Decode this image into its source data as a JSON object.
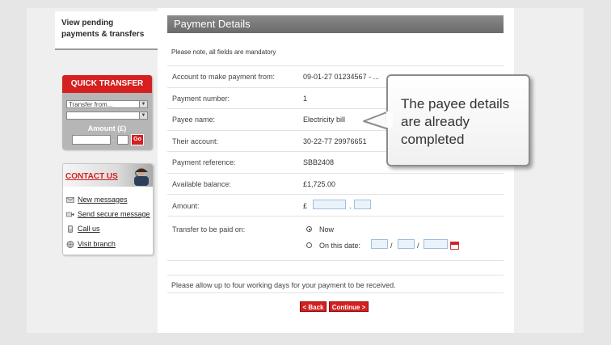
{
  "sidebar": {
    "pending_link": "View pending payments & transfers",
    "quick_transfer": {
      "title": "QUICK TRANSFER",
      "transfer_from": "Transfer from...",
      "amount_label": "Amount (£)",
      "dot": ".",
      "go": "Go"
    },
    "contact": {
      "title": "CONTACT US",
      "items": [
        "New messages",
        "Send secure message",
        "Call us",
        "Visit branch"
      ]
    }
  },
  "panel": {
    "title": "Payment Details",
    "note": "Please note, all fields are mandatory",
    "rows": [
      {
        "label": "Account to make payment from:",
        "value": "09-01-27 01234567 - ..."
      },
      {
        "label": "Payment number:",
        "value": "1"
      },
      {
        "label": "Payee name:",
        "value": "Electricity bill"
      },
      {
        "label": "Their account:",
        "value": "30-22-77 29976651"
      },
      {
        "label": "Payment reference:",
        "value": "SBB2408"
      },
      {
        "label": "Available balance:",
        "value": "£1,725.00"
      },
      {
        "label": "Amount:",
        "value": "£"
      },
      {
        "label": "Transfer to be paid on:",
        "value": ""
      }
    ],
    "amount_dot": ".",
    "option_now": "Now",
    "option_date": "On this date:",
    "date_sep": "/",
    "footer_note": "Please allow up to four working days for your payment to be received.",
    "back_button": "< Back",
    "continue_button": "Continue >"
  },
  "callout": {
    "text": "The payee details are already completed"
  },
  "colors": {
    "brand_red": "#d61f1f",
    "header_gray": "#7a7a7a",
    "input_fill": "#eaf2fb"
  }
}
